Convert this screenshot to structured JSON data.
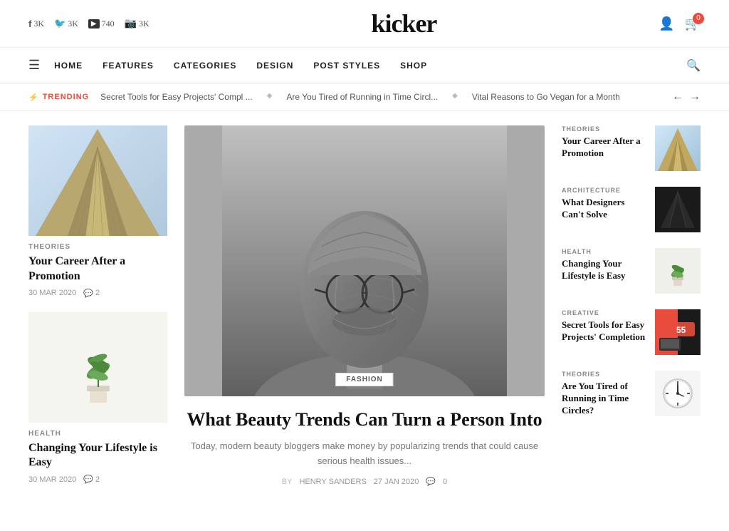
{
  "site": {
    "title": "kicker"
  },
  "social": [
    {
      "icon": "f",
      "label": "3K",
      "network": "facebook"
    },
    {
      "icon": "🐦",
      "label": "3K",
      "network": "twitter"
    },
    {
      "icon": "▶",
      "label": "740",
      "network": "youtube"
    },
    {
      "icon": "📷",
      "label": "3K",
      "network": "instagram"
    }
  ],
  "nav": {
    "links": [
      "HOME",
      "FEATURES",
      "CATEGORIES",
      "DESIGN",
      "POST STYLES",
      "SHOP"
    ]
  },
  "trending": {
    "label": "TRENDING",
    "items": [
      "Secret Tools for Easy Projects' Compl ...",
      "Are You Tired of Running in Time Circl...",
      "Vital Reasons to Go Vegan for a Month"
    ]
  },
  "left_cards": [
    {
      "tag": "THEORIES",
      "title": "Your Career After a Promotion",
      "date": "30 MAR 2020",
      "comments": "2",
      "img_type": "building"
    },
    {
      "tag": "HEALTH",
      "title": "Changing Your Lifestyle is Easy",
      "date": "30 MAR 2020",
      "comments": "2",
      "img_type": "plant"
    }
  ],
  "featured": {
    "tag": "FASHION",
    "title": "What Beauty Trends Can Turn a Person Into",
    "excerpt": "Today, modern beauty bloggers make money by popularizing trends that could cause serious health issues...",
    "author": "HENRY SANDERS",
    "date": "27 JAN 2020",
    "comments": "0",
    "by_label": "BY"
  },
  "sidebar_cards": [
    {
      "tag": "THEORIES",
      "title": "Your Career After a Promotion",
      "thumb_type": "building"
    },
    {
      "tag": "ARCHITECTURE",
      "title": "What Designers Can't Solve",
      "thumb_type": "dark"
    },
    {
      "tag": "HEALTH",
      "title": "Changing Your Lifestyle is Easy",
      "thumb_type": "plant"
    },
    {
      "tag": "CREATIVE",
      "title": "Secret Tools for Easy Projects' Completion",
      "thumb_type": "tools"
    },
    {
      "tag": "THEORIES",
      "title": "Are You Tired of Running in Time Circles?",
      "thumb_type": "clock"
    }
  ],
  "cart": {
    "count": "0"
  }
}
